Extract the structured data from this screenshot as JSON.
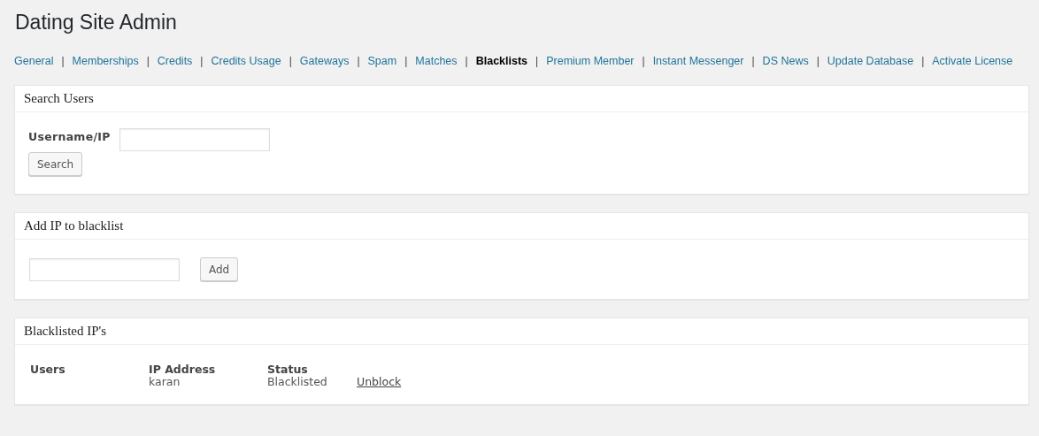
{
  "title": "Dating Site Admin",
  "nav": {
    "separator": "|",
    "items": [
      {
        "label": "General",
        "selected": false
      },
      {
        "label": "Memberships",
        "selected": false
      },
      {
        "label": "Credits",
        "selected": false
      },
      {
        "label": "Credits Usage",
        "selected": false
      },
      {
        "label": "Gateways",
        "selected": false
      },
      {
        "label": "Spam",
        "selected": false
      },
      {
        "label": "Matches",
        "selected": false
      },
      {
        "label": "Blacklists",
        "selected": true
      },
      {
        "label": "Premium Member",
        "selected": false
      },
      {
        "label": "Instant Messenger",
        "selected": false
      },
      {
        "label": "DS News",
        "selected": false
      },
      {
        "label": "Update Database",
        "selected": false
      },
      {
        "label": "Activate License",
        "selected": false
      }
    ]
  },
  "search_panel": {
    "title": "Search Users",
    "label": "Username/IP",
    "button": "Search"
  },
  "add_panel": {
    "title": "Add IP to blacklist",
    "button": "Add"
  },
  "blacklist_panel": {
    "title": "Blacklisted IP's",
    "columns": [
      "Users",
      "IP Address",
      "Status"
    ],
    "rows": [
      {
        "ip_address": "karan",
        "status": "Blacklisted",
        "action": "Unblock"
      }
    ]
  }
}
